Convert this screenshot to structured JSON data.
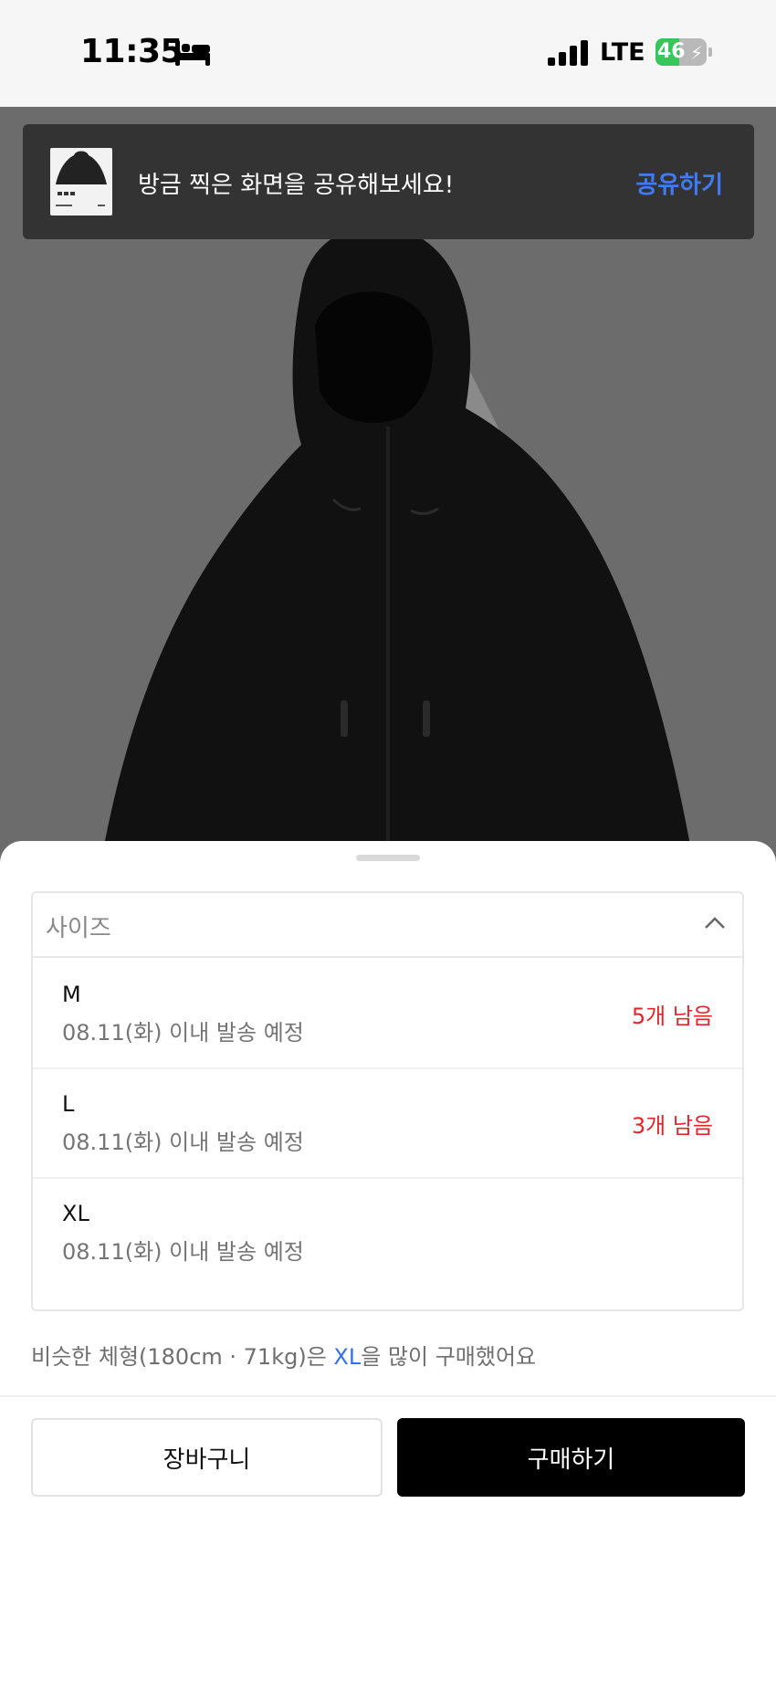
{
  "status_bar": {
    "time": "11:35",
    "network": "LTE",
    "battery_level": "46",
    "battery_percent": 46,
    "icons": [
      "bed-icon",
      "signal-icon",
      "battery-charging-icon"
    ]
  },
  "share_banner": {
    "message": "방금 찍은 화면을 공유해보세요!",
    "action": "공유하기"
  },
  "size_selector": {
    "placeholder": "사이즈",
    "options": [
      {
        "name": "M",
        "shipping": "08.11(화) 이내 발송 예정",
        "stock": "5개 남음"
      },
      {
        "name": "L",
        "shipping": "08.11(화) 이내 발송 예정",
        "stock": "3개 남음"
      },
      {
        "name": "XL",
        "shipping": "08.11(화) 이내 발송 예정",
        "stock": ""
      }
    ]
  },
  "recommendation": {
    "prefix": "비슷한 체형(180cm · 71kg)은 ",
    "highlight": "XL",
    "suffix": "을 많이 구매했어요"
  },
  "actions": {
    "cart_label": "장바구니",
    "buy_label": "구매하기"
  },
  "colors": {
    "accent_blue": "#3f7bf5",
    "stock_red": "#e2262b",
    "buy_button": "#000000",
    "battery_green": "#35c759"
  }
}
